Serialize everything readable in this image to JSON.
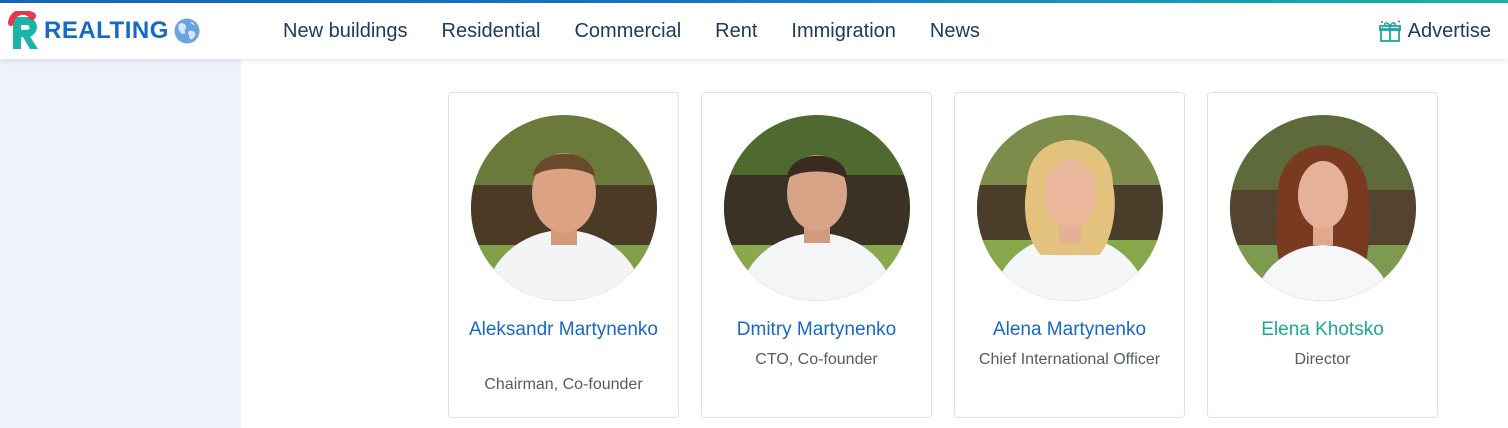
{
  "header": {
    "logo_text": "REALTING",
    "nav": [
      "New buildings",
      "Residential",
      "Commercial",
      "Rent",
      "Immigration",
      "News"
    ],
    "advertise_label": "Advertise"
  },
  "team": [
    {
      "name": "Aleksandr Martynenko",
      "role": "Chairman, Co-founder"
    },
    {
      "name": "Dmitry Martynenko",
      "role": "CTO, Co-founder"
    },
    {
      "name": "Alena Martynenko",
      "role": "Chief International Officer"
    },
    {
      "name": "Elena Khotsko",
      "role": "Director"
    }
  ],
  "colors": {
    "brand_blue": "#1769c6",
    "brand_teal": "#1aa89d",
    "sidebar_bg": "#eef2fa"
  },
  "icons": [
    "realting-logo-icon",
    "globe-icon",
    "gift-icon"
  ]
}
